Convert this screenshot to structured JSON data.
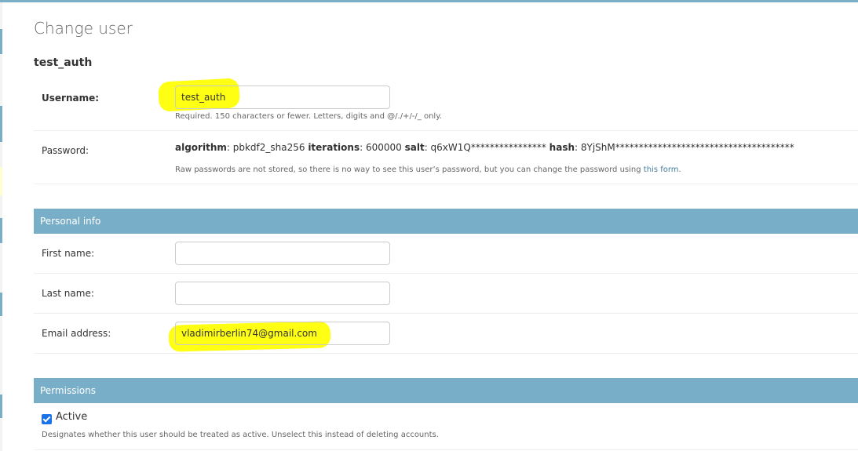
{
  "page": {
    "title": "Change user",
    "object_name": "test_auth"
  },
  "fields": {
    "username": {
      "label": "Username:",
      "value": "test_auth",
      "help": "Required. 150 characters or fewer. Letters, digits and @/./+/-/_ only."
    },
    "password": {
      "label": "Password:",
      "algorithm_key": "algorithm",
      "algorithm_value": ": pbkdf2_sha256 ",
      "iterations_key": "iterations",
      "iterations_value": ": 600000 ",
      "salt_key": "salt",
      "salt_value": ": q6xW1Q**************** ",
      "hash_key": "hash",
      "hash_value": ": 8YjShM**************************************",
      "help_prefix": "Raw passwords are not stored, so there is no way to see this user’s password, but you can change the password using ",
      "help_link": "this form",
      "help_suffix": "."
    }
  },
  "personal_info": {
    "heading": "Personal info",
    "first_name": {
      "label": "First name:",
      "value": ""
    },
    "last_name": {
      "label": "Last name:",
      "value": ""
    },
    "email": {
      "label": "Email address:",
      "value": "vladimirberlin74@gmail.com"
    }
  },
  "permissions": {
    "heading": "Permissions",
    "active": {
      "label": "Active",
      "checked": true,
      "help": "Designates whether this user should be treated as active. Unselect this instead of deleting accounts."
    }
  },
  "colors": {
    "module_header": "#79aec8",
    "highlight": "#ffff00",
    "link": "#447e9b",
    "checkbox": "#1a73e8"
  }
}
